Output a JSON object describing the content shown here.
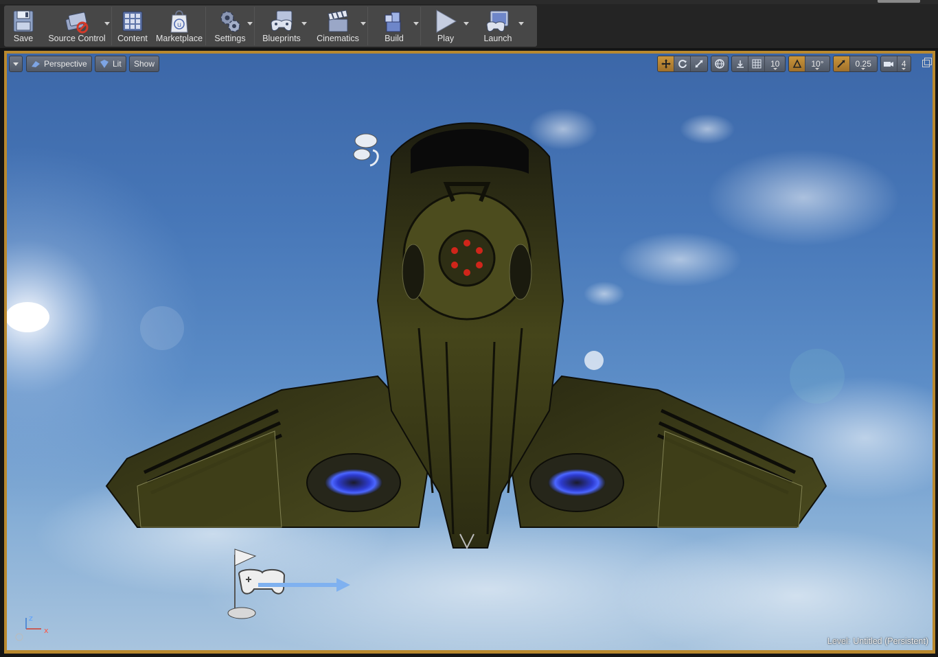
{
  "toolbar": {
    "items": [
      {
        "label": "Save",
        "icon": "save-icon"
      },
      {
        "label": "Source Control",
        "icon": "source-control-icon"
      },
      {
        "label": "Content",
        "icon": "content-icon"
      },
      {
        "label": "Marketplace",
        "icon": "marketplace-icon"
      },
      {
        "label": "Settings",
        "icon": "settings-icon"
      },
      {
        "label": "Blueprints",
        "icon": "blueprints-icon"
      },
      {
        "label": "Cinematics",
        "icon": "cinematics-icon"
      },
      {
        "label": "Build",
        "icon": "build-icon"
      },
      {
        "label": "Play",
        "icon": "play-icon"
      },
      {
        "label": "Launch",
        "icon": "launch-icon"
      }
    ]
  },
  "viewport": {
    "view_mode": "Perspective",
    "lighting_mode": "Lit",
    "show_label": "Show",
    "grid_snap": "10",
    "rotation_snap": "10°",
    "scale_snap": "0.25",
    "camera_speed": "4",
    "level_label": "Level:",
    "level_name": "Untitled (Persistent)",
    "axis_z": "z",
    "axis_x": "x"
  },
  "colors": {
    "accent": "#b9892f",
    "toolbar": "#474747",
    "sky_top": "#3c67a8",
    "sky_bottom": "#a8c4de",
    "ship_hull": "#3e3e16",
    "thruster": "#3a5cff"
  }
}
